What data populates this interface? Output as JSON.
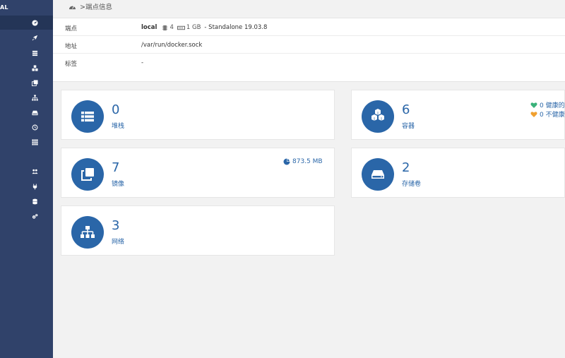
{
  "sidebar": {
    "brand": "AL",
    "icons": [
      "dashboard-icon",
      "rocket-icon",
      "list-icon",
      "cubes-icon",
      "clone-icon",
      "sitemap-icon",
      "hdd-icon",
      "history-icon",
      "grid-icon",
      "users-icon",
      "plug-icon",
      "database-icon",
      "cogs-icon"
    ]
  },
  "breadcrumb": {
    "text": ">端点信息"
  },
  "endpoint": {
    "rows": [
      {
        "key": "端点",
        "name": "local",
        "cpu": "4",
        "memory": "1 GB",
        "details": "- Standalone 19.03.8"
      },
      {
        "key": "地址",
        "value": "/var/run/docker.sock"
      },
      {
        "key": "标签",
        "value": "-"
      }
    ]
  },
  "cards": {
    "stacks": {
      "count": "0",
      "label": "堆栈"
    },
    "containers": {
      "count": "6",
      "label": "容器",
      "healthy": "0 健康的",
      "unhealthy": "0 不健康"
    },
    "images": {
      "count": "7",
      "label": "镜像",
      "size": "873.5 MB"
    },
    "volumes": {
      "count": "2",
      "label": "存储卷"
    },
    "networks": {
      "count": "3",
      "label": "网络"
    }
  },
  "colors": {
    "sidebar": "#30426a",
    "accent": "#2a66a8",
    "healthy": "#3ab27a",
    "unhealthy": "#f0a030"
  }
}
